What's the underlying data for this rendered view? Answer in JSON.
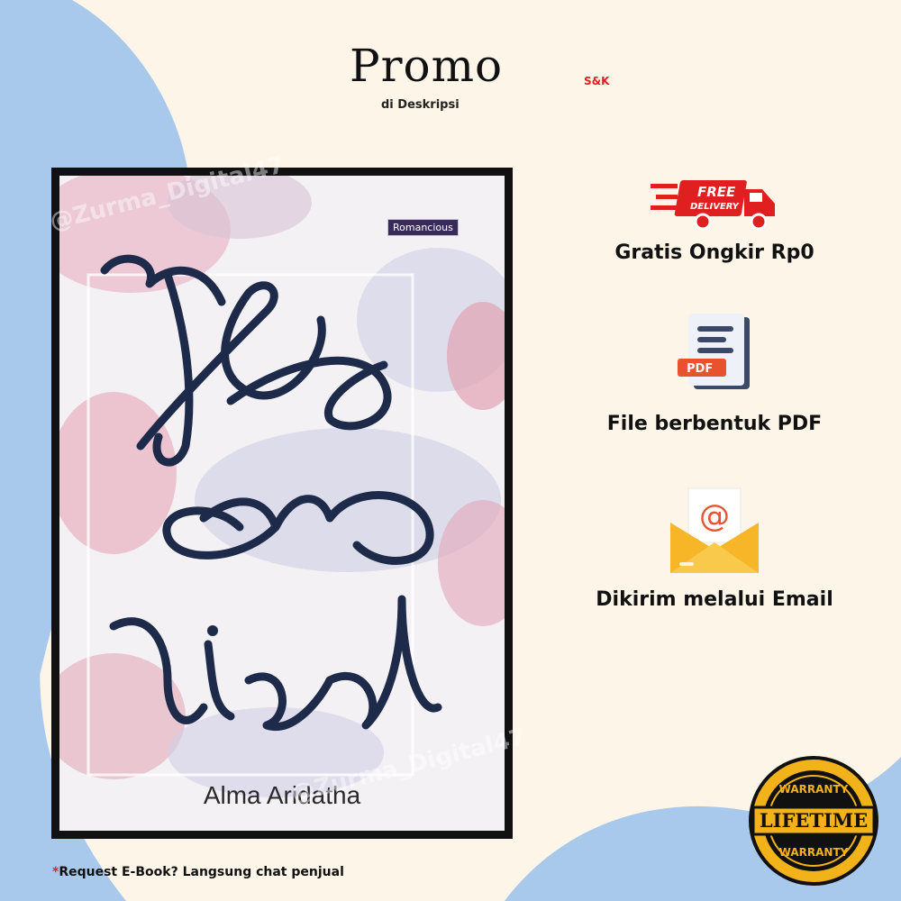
{
  "promo": {
    "title": "Promo",
    "subtitle": "di Deskripsi",
    "terms": "S&K"
  },
  "book": {
    "publisher": "Romancious",
    "title_art": "Re tied",
    "author": "Alma Aridatha",
    "watermark": "@Zurma_Digital47"
  },
  "features": [
    {
      "label": "Gratis Ongkir Rp0",
      "icon": "free-delivery-truck-icon",
      "badge_text_1": "FREE",
      "badge_text_2": "DELIVERY"
    },
    {
      "label": "File berbentuk PDF",
      "icon": "pdf-file-icon",
      "tag": "PDF"
    },
    {
      "label": "Dikirim melalui Email",
      "icon": "email-envelope-icon"
    }
  ],
  "warranty_badge": {
    "top": "WARRANTY",
    "center": "LIFETIME",
    "bottom": "WARRANTY"
  },
  "footnote": {
    "star": "*",
    "text": "Request E-Book? Langsung chat penjual"
  },
  "colors": {
    "background": "#fdf6e8",
    "blue_wave": "#a9c9ec",
    "accent_red": "#e02020",
    "badge_gold": "#f2b31a"
  }
}
